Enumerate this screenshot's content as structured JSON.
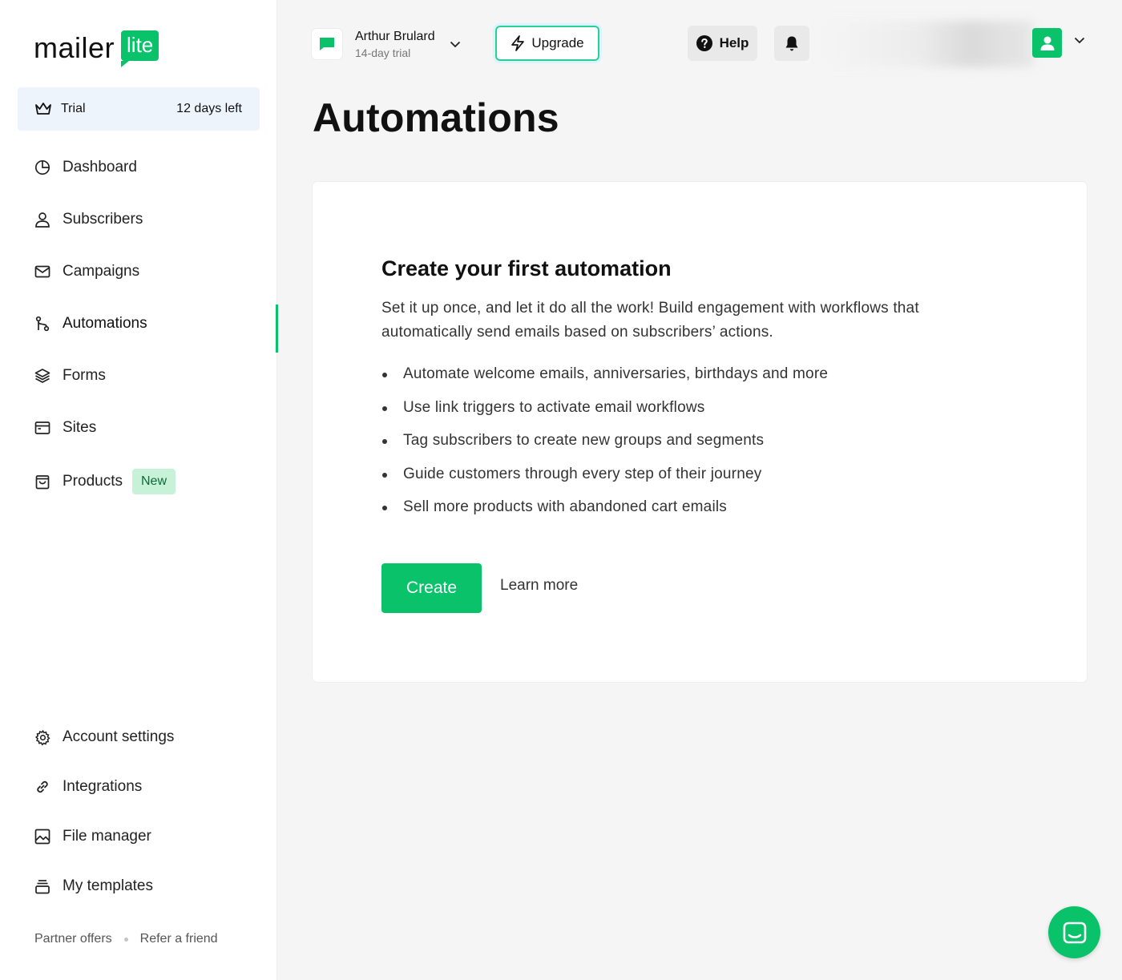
{
  "brand": {
    "logo_word": "mailer",
    "logo_badge": "lite",
    "accent_color": "#09c269"
  },
  "trial": {
    "label": "Trial",
    "days_left": "12 days left",
    "icon": "crown-icon"
  },
  "sidebar": {
    "items": [
      {
        "label": "Dashboard",
        "icon": "dashboard-icon"
      },
      {
        "label": "Subscribers",
        "icon": "user-icon"
      },
      {
        "label": "Campaigns",
        "icon": "mail-icon"
      },
      {
        "label": "Automations",
        "icon": "automation-icon",
        "active": true
      },
      {
        "label": "Forms",
        "icon": "layers-icon"
      },
      {
        "label": "Sites",
        "icon": "browser-icon"
      },
      {
        "label": "Products",
        "icon": "shopping-bag-icon",
        "badge": "New"
      }
    ],
    "bottom_items": [
      {
        "label": "Account settings",
        "icon": "gear-icon"
      },
      {
        "label": "Integrations",
        "icon": "link-icon"
      },
      {
        "label": "File manager",
        "icon": "image-icon"
      },
      {
        "label": "My templates",
        "icon": "templates-icon"
      }
    ],
    "footer": {
      "partner_offers": "Partner offers",
      "refer_friend": "Refer a friend"
    }
  },
  "header": {
    "account_name": "Arthur Brulard",
    "account_sub": "14-day trial",
    "upgrade_label": "Upgrade",
    "help_label": "Help"
  },
  "page": {
    "title": "Automations"
  },
  "card": {
    "heading": "Create your first automation",
    "description": "Set it up once, and let it do all the work! Build engagement with workflows that automatically send emails based on subscribers’ actions.",
    "bullets": [
      "Automate welcome emails, anniversaries, birthdays and more",
      "Use link triggers to activate email workflows",
      "Tag subscribers to create new groups and segments",
      "Guide customers through every step of their journey",
      "Sell more products with abandoned cart emails"
    ],
    "create_label": "Create",
    "learn_more_label": "Learn more"
  }
}
